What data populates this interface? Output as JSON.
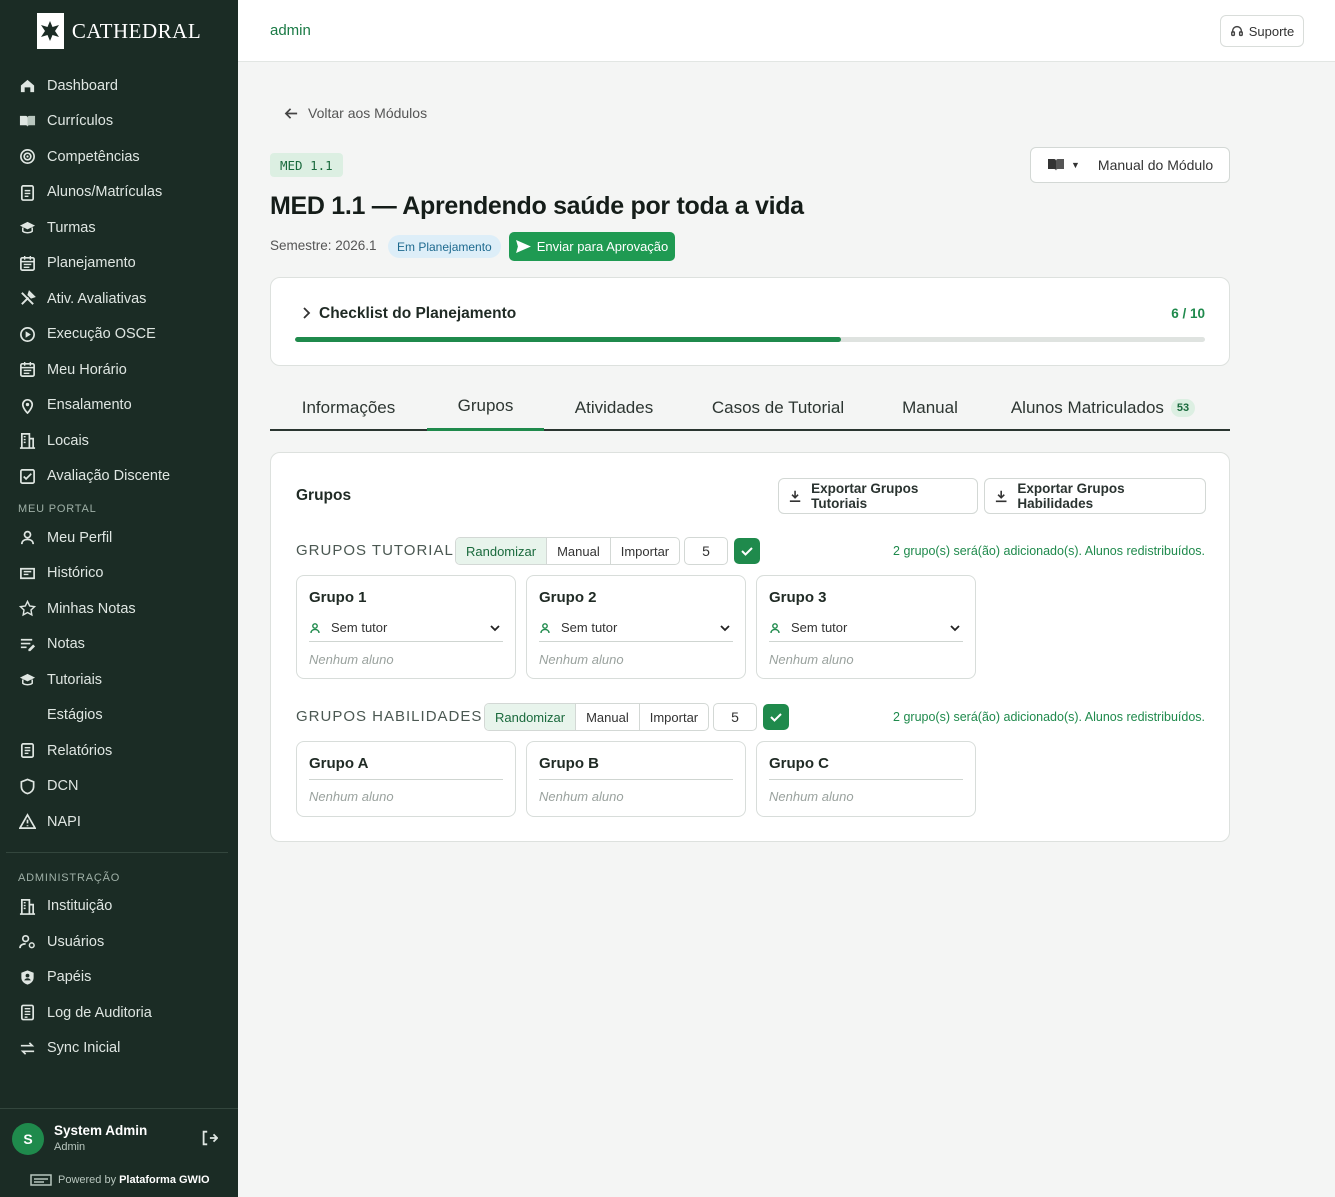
{
  "brand": {
    "name": "CATHEDRAL"
  },
  "sidebar": {
    "items": [
      {
        "label": "Dashboard",
        "icon": "home-icon"
      },
      {
        "label": "Currículos",
        "icon": "book-open-icon"
      },
      {
        "label": "Competências",
        "icon": "target-icon"
      },
      {
        "label": "Alunos/Matrículas",
        "icon": "clipboard-icon"
      },
      {
        "label": "Turmas",
        "icon": "graduation-cap-icon"
      },
      {
        "label": "Planejamento",
        "icon": "calendar-icon"
      },
      {
        "label": "Ativ. Avaliativas",
        "icon": "tools-icon"
      },
      {
        "label": "Execução OSCE",
        "icon": "play-circle-icon"
      },
      {
        "label": "Meu Horário",
        "icon": "calendar-icon"
      },
      {
        "label": "Ensalamento",
        "icon": "map-pin-icon"
      },
      {
        "label": "Locais",
        "icon": "building-icon"
      },
      {
        "label": "Avaliação Discente",
        "icon": "checklist-icon"
      }
    ],
    "portal_section": "MEU PORTAL",
    "portal_items": [
      {
        "label": "Meu Perfil",
        "icon": "user-icon"
      },
      {
        "label": "Histórico",
        "icon": "history-icon"
      },
      {
        "label": "Minhas Notas",
        "icon": "star-icon"
      },
      {
        "label": "Notas",
        "icon": "notes-icon"
      },
      {
        "label": "Tutoriais",
        "icon": "graduation-cap-icon"
      },
      {
        "label": "Estágios",
        "icon": ""
      },
      {
        "label": "Relatórios",
        "icon": "report-icon"
      },
      {
        "label": "DCN",
        "icon": "shield-icon"
      },
      {
        "label": "NAPI",
        "icon": "warning-icon"
      }
    ],
    "admin_section": "ADMINISTRAÇÃO",
    "admin_items": [
      {
        "label": "Instituição",
        "icon": "building-icon"
      },
      {
        "label": "Usuários",
        "icon": "users-cog-icon"
      },
      {
        "label": "Papéis",
        "icon": "shield-user-icon"
      },
      {
        "label": "Log de Auditoria",
        "icon": "log-icon"
      },
      {
        "label": "Sync Inicial",
        "icon": "sync-icon"
      }
    ],
    "user": {
      "initial": "S",
      "name": "System Admin",
      "role": "Admin"
    },
    "powered_prefix": "Powered by",
    "powered_brand": "Plataforma GWIO"
  },
  "header": {
    "user": "admin",
    "support_label": "Suporte"
  },
  "page": {
    "back_label": "Voltar aos Módulos",
    "code": "MED 1.1",
    "manual_label": "Manual do Módulo",
    "title": "MED 1.1 — Aprendendo saúde por toda a vida",
    "semester": "Semestre: 2026.1",
    "status": "Em Planejamento",
    "send_label": "Enviar para Aprovação"
  },
  "checklist": {
    "title": "Checklist do Planejamento",
    "count": "6 / 10",
    "progress": 0.6
  },
  "tabs": [
    {
      "label": "Informações"
    },
    {
      "label": "Grupos"
    },
    {
      "label": "Atividades"
    },
    {
      "label": "Casos de Tutorial"
    },
    {
      "label": "Manual"
    },
    {
      "label": "Alunos Matriculados",
      "count": "53"
    }
  ],
  "groups": {
    "title": "Grupos",
    "export_tutorial": "Exportar Grupos Tutoriais",
    "export_skills": "Exportar Grupos Habilidades",
    "tutorial": {
      "label": "GRUPOS TUTORIAL",
      "modes": [
        "Randomizar",
        "Manual",
        "Importar"
      ],
      "count": "5",
      "note": "2 grupo(s) será(ão) adicionado(s). Alunos redistribuídos.",
      "cards": [
        {
          "name": "Grupo 1",
          "tutor": "Sem tutor",
          "empty": "Nenhum aluno"
        },
        {
          "name": "Grupo 2",
          "tutor": "Sem tutor",
          "empty": "Nenhum aluno"
        },
        {
          "name": "Grupo 3",
          "tutor": "Sem tutor",
          "empty": "Nenhum aluno"
        }
      ]
    },
    "skills": {
      "label": "GRUPOS HABILIDADES",
      "modes": [
        "Randomizar",
        "Manual",
        "Importar"
      ],
      "count": "5",
      "note": "2 grupo(s) será(ão) adicionado(s). Alunos redistribuídos.",
      "cards": [
        {
          "name": "Grupo A",
          "empty": "Nenhum aluno"
        },
        {
          "name": "Grupo B",
          "empty": "Nenhum aluno"
        },
        {
          "name": "Grupo C",
          "empty": "Nenhum aluno"
        }
      ]
    }
  },
  "colors": {
    "sidebar": "#1b2c25",
    "accent": "#1f8a4c",
    "badge_blue": "#ddeef8"
  }
}
